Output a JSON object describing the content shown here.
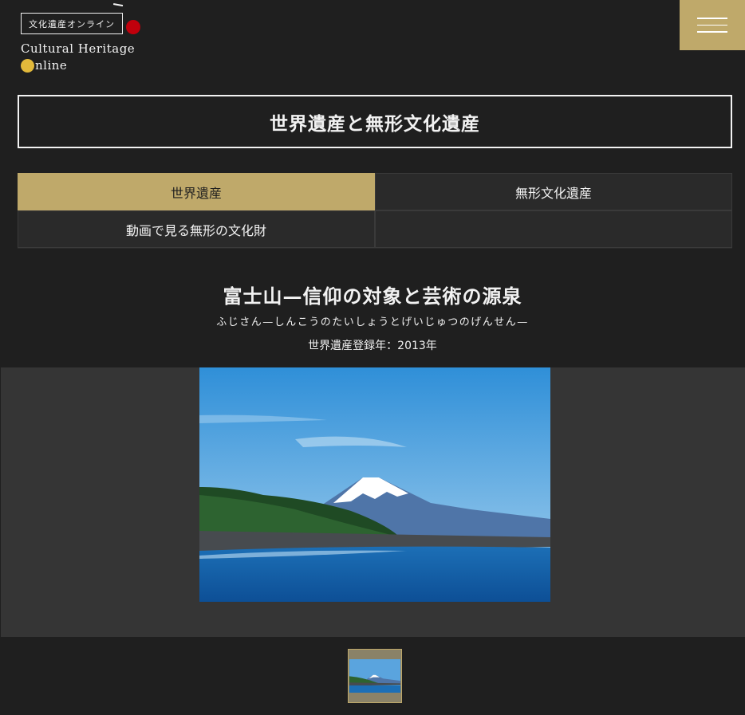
{
  "header": {
    "logo_jp": "文化遺産オンライン",
    "logo_en_line1": "Cultural Heritage",
    "logo_en_line2": "nline",
    "menu_icon": "hamburger-icon",
    "colors": {
      "gold": "#bfa96a",
      "red_dot": "#c0000c",
      "yellow_dot": "#e2b93b"
    }
  },
  "page_title": "世界遺産と無形文化遺産",
  "tabs": [
    {
      "label": "世界遺産",
      "active": true
    },
    {
      "label": "無形文化遺産",
      "active": false
    },
    {
      "label": "動画で見る無形の文化財",
      "active": false
    }
  ],
  "heritage": {
    "title": "富士山—信仰の対象と芸術の源泉",
    "reading": "ふじさん—しんこうのたいしょうとげいじゅつのげんせん—",
    "year": "世界遺産登録年：2013年"
  },
  "gallery": {
    "thumbnail_count": 1
  }
}
